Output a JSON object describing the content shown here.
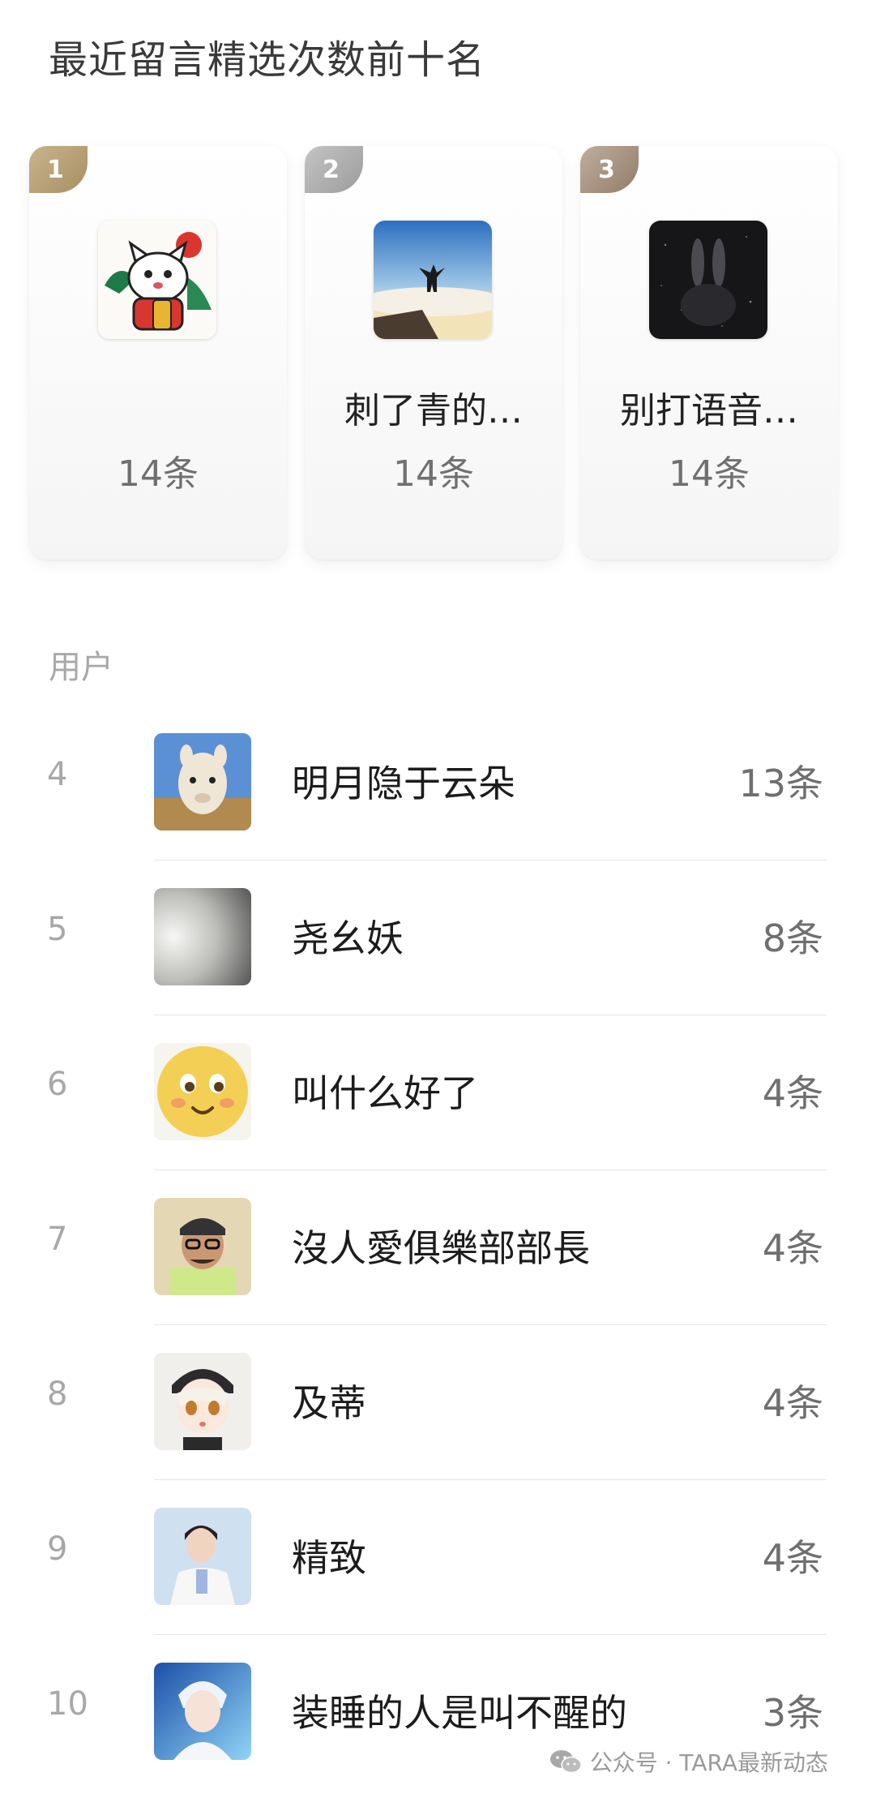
{
  "page": {
    "title": "最近留言精选次数前十名"
  },
  "top3": [
    {
      "rank": "1",
      "name": "",
      "count": "14条",
      "avatar": "lucky-cat-avatar-icon",
      "badge_color": "#b59f75"
    },
    {
      "rank": "2",
      "name": "刺了青的…",
      "count": "14条",
      "avatar": "mountain-sunrise-avatar-icon",
      "badge_color": "#aaaaaa"
    },
    {
      "rank": "3",
      "name": "别打语音…",
      "count": "14条",
      "avatar": "rabbit-silhouette-avatar-icon",
      "badge_color": "#a68f7d"
    }
  ],
  "section": {
    "label": "用户"
  },
  "list": [
    {
      "rank": "4",
      "name": "明月隐于云朵",
      "count": "13条",
      "avatar": "alpaca-avatar-icon"
    },
    {
      "rank": "5",
      "name": "尧幺妖",
      "count": "8条",
      "avatar": "gray-blur-avatar-icon"
    },
    {
      "rank": "6",
      "name": "叫什么好了",
      "count": "4条",
      "avatar": "smiley-face-avatar-icon"
    },
    {
      "rank": "7",
      "name": "沒人愛俱樂部部長",
      "count": "4条",
      "avatar": "man-with-cap-avatar-icon"
    },
    {
      "rank": "8",
      "name": "及蒂",
      "count": "4条",
      "avatar": "anime-boy-avatar-icon"
    },
    {
      "rank": "9",
      "name": "精致",
      "count": "4条",
      "avatar": "doctor-avatar-icon"
    },
    {
      "rank": "10",
      "name": "装睡的人是叫不醒的",
      "count": "3条",
      "avatar": "anime-blue-avatar-icon"
    }
  ],
  "watermark": {
    "text": "公众号 · TARA最新动态",
    "icon": "wechat-icon"
  }
}
